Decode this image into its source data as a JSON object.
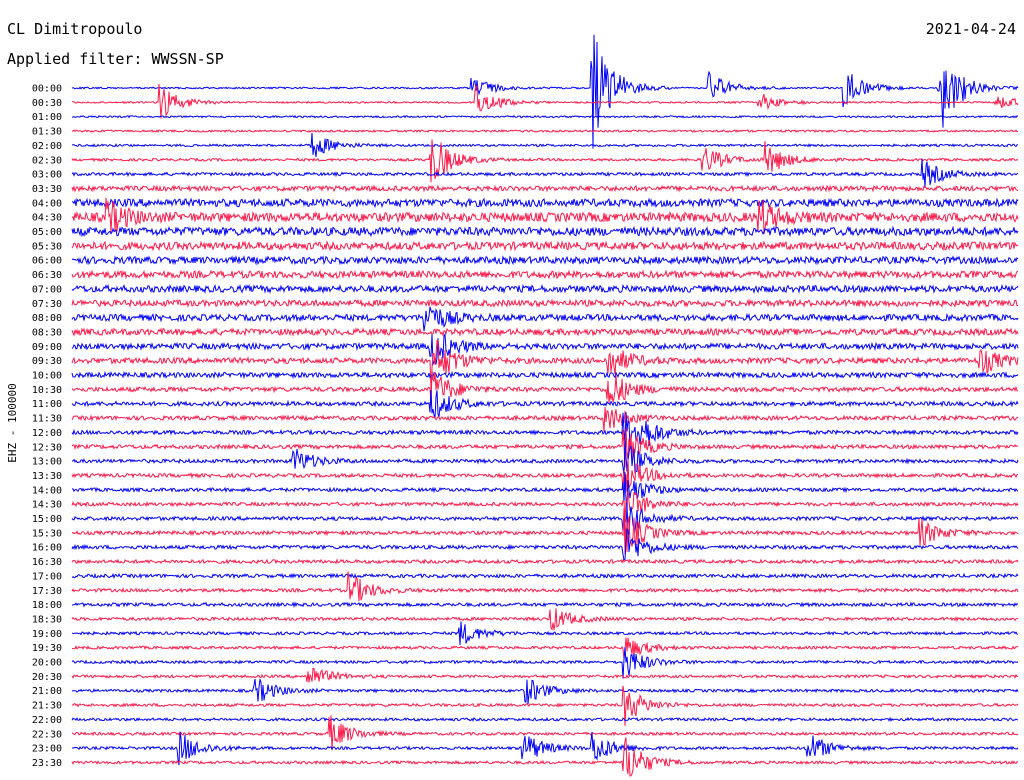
{
  "header": {
    "station": "CL Dimitropoulo",
    "filter": "Applied filter: WWSSN-SP",
    "date": "2021-04-24"
  },
  "chart_data": {
    "type": "line",
    "title": "",
    "ylabel": "EHZ - 100000",
    "row_labels": [
      "00:00",
      "00:30",
      "01:00",
      "01:30",
      "02:00",
      "02:30",
      "03:00",
      "03:30",
      "04:00",
      "04:30",
      "05:00",
      "05:30",
      "06:00",
      "06:30",
      "07:00",
      "07:30",
      "08:00",
      "08:30",
      "09:00",
      "09:30",
      "10:00",
      "10:30",
      "11:00",
      "11:30",
      "12:00",
      "12:30",
      "13:00",
      "13:30",
      "14:00",
      "14:30",
      "15:00",
      "15:30",
      "16:00",
      "16:30",
      "17:00",
      "17:30",
      "18:00",
      "18:30",
      "19:00",
      "19:30",
      "20:00",
      "20:30",
      "21:00",
      "21:30",
      "22:00",
      "22:30",
      "23:00",
      "23:30"
    ],
    "series_colors": [
      "#0000ff",
      "#ff1a4a"
    ],
    "background_noise": [
      0.12,
      0.12,
      0.13,
      0.14,
      0.16,
      0.18,
      0.22,
      0.35,
      0.55,
      0.65,
      0.6,
      0.55,
      0.5,
      0.5,
      0.48,
      0.45,
      0.45,
      0.45,
      0.42,
      0.4,
      0.36,
      0.32,
      0.3,
      0.3,
      0.28,
      0.28,
      0.26,
      0.26,
      0.25,
      0.25,
      0.26,
      0.26,
      0.26,
      0.25,
      0.25,
      0.24,
      0.24,
      0.22,
      0.2,
      0.2,
      0.2,
      0.2,
      0.2,
      0.2,
      0.2,
      0.2,
      0.2,
      0.2
    ],
    "events": [
      {
        "row": 0,
        "minute": 16.5,
        "amplitude": 9
      },
      {
        "row": 0,
        "minute": 24.5,
        "amplitude": 3
      },
      {
        "row": 0,
        "minute": 12.7,
        "amplitude": 1.5
      },
      {
        "row": 0,
        "minute": 20.2,
        "amplitude": 2.5
      },
      {
        "row": 0,
        "minute": 27.5,
        "amplitude": 7
      },
      {
        "row": 1,
        "minute": 12.8,
        "amplitude": 2.5
      },
      {
        "row": 1,
        "minute": 2.8,
        "amplitude": 2.5
      },
      {
        "row": 1,
        "minute": 21.8,
        "amplitude": 1.5
      },
      {
        "row": 1,
        "minute": 29.3,
        "amplitude": 1.2
      },
      {
        "row": 4,
        "minute": 7.6,
        "amplitude": 2
      },
      {
        "row": 5,
        "minute": 11.4,
        "amplitude": 4
      },
      {
        "row": 5,
        "minute": 20.0,
        "amplitude": 2.2
      },
      {
        "row": 5,
        "minute": 22.0,
        "amplitude": 2.5
      },
      {
        "row": 6,
        "minute": 27.0,
        "amplitude": 2
      },
      {
        "row": 9,
        "minute": 1.1,
        "amplitude": 2.5
      },
      {
        "row": 9,
        "minute": 21.8,
        "amplitude": 2.5
      },
      {
        "row": 16,
        "minute": 11.2,
        "amplitude": 2.5
      },
      {
        "row": 18,
        "minute": 11.4,
        "amplitude": 3
      },
      {
        "row": 19,
        "minute": 11.4,
        "amplitude": 4
      },
      {
        "row": 19,
        "minute": 17.0,
        "amplitude": 2.5
      },
      {
        "row": 19,
        "minute": 28.8,
        "amplitude": 2
      },
      {
        "row": 21,
        "minute": 11.4,
        "amplitude": 3
      },
      {
        "row": 21,
        "minute": 17.0,
        "amplitude": 3
      },
      {
        "row": 22,
        "minute": 11.4,
        "amplitude": 2.5
      },
      {
        "row": 23,
        "minute": 16.9,
        "amplitude": 2.2
      },
      {
        "row": 24,
        "minute": 17.5,
        "amplitude": 3
      },
      {
        "row": 24,
        "minute": 18.0,
        "amplitude": 1.8
      },
      {
        "row": 25,
        "minute": 17.5,
        "amplitude": 3
      },
      {
        "row": 26,
        "minute": 7.0,
        "amplitude": 2
      },
      {
        "row": 26,
        "minute": 17.5,
        "amplitude": 3
      },
      {
        "row": 27,
        "minute": 17.5,
        "amplitude": 3
      },
      {
        "row": 28,
        "minute": 17.5,
        "amplitude": 3
      },
      {
        "row": 29,
        "minute": 17.5,
        "amplitude": 3
      },
      {
        "row": 30,
        "minute": 17.5,
        "amplitude": 3
      },
      {
        "row": 31,
        "minute": 17.5,
        "amplitude": 3.5
      },
      {
        "row": 31,
        "minute": 26.9,
        "amplitude": 2
      },
      {
        "row": 32,
        "minute": 17.5,
        "amplitude": 3
      },
      {
        "row": 35,
        "minute": 8.8,
        "amplitude": 2.5
      },
      {
        "row": 37,
        "minute": 15.2,
        "amplitude": 1.8
      },
      {
        "row": 38,
        "minute": 12.3,
        "amplitude": 1.8
      },
      {
        "row": 39,
        "minute": 17.5,
        "amplitude": 2
      },
      {
        "row": 40,
        "minute": 17.5,
        "amplitude": 2.5
      },
      {
        "row": 41,
        "minute": 7.5,
        "amplitude": 1.8
      },
      {
        "row": 42,
        "minute": 5.8,
        "amplitude": 2
      },
      {
        "row": 42,
        "minute": 14.4,
        "amplitude": 2
      },
      {
        "row": 43,
        "minute": 17.5,
        "amplitude": 3
      },
      {
        "row": 45,
        "minute": 8.2,
        "amplitude": 2.5
      },
      {
        "row": 46,
        "minute": 3.4,
        "amplitude": 2.5
      },
      {
        "row": 46,
        "minute": 14.3,
        "amplitude": 2.5
      },
      {
        "row": 46,
        "minute": 16.5,
        "amplitude": 2.5
      },
      {
        "row": 46,
        "minute": 23.3,
        "amplitude": 2.5
      },
      {
        "row": 47,
        "minute": 17.5,
        "amplitude": 4
      }
    ]
  }
}
